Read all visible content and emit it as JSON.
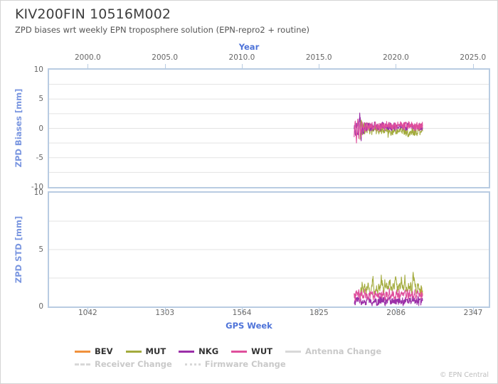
{
  "header": {
    "title": "KIV200FIN 10516M002",
    "subtitle": "ZPD biases wrt weekly EPN troposphere solution (EPN-repro2 + routine)"
  },
  "footer": {
    "copyright": "© EPN Central"
  },
  "colors": {
    "bev": "#f0913c",
    "mut": "#a3ab3d",
    "nkg": "#9b2fa8",
    "wut": "#df4f9c",
    "axis_title": "#4f74d9",
    "vaxis_title": "#7a96e0",
    "frame": "#b9cce2",
    "grid": "#e3e3e3",
    "tick_text": "#666666",
    "muted": "#d8d8d8"
  },
  "legend": {
    "series": [
      {
        "key": "bev",
        "label": "BEV",
        "color": "#f0913c",
        "style": "solid",
        "muted": false
      },
      {
        "key": "mut",
        "label": "MUT",
        "color": "#a3ab3d",
        "style": "solid",
        "muted": false
      },
      {
        "key": "nkg",
        "label": "NKG",
        "color": "#9b2fa8",
        "style": "solid",
        "muted": false
      },
      {
        "key": "wut",
        "label": "WUT",
        "color": "#df4f9c",
        "style": "solid",
        "muted": false
      },
      {
        "key": "antenna_change",
        "label": "Antenna Change",
        "color": "#d8d8d8",
        "style": "solid",
        "muted": true
      },
      {
        "key": "receiver_change",
        "label": "Receiver Change",
        "color": "#d8d8d8",
        "style": "dashed",
        "muted": true
      },
      {
        "key": "firmware_change",
        "label": "Firmware Change",
        "color": "#d8d8d8",
        "style": "dotted",
        "muted": true
      }
    ]
  },
  "chart_data": [
    {
      "id": "zpd-biases",
      "type": "line",
      "title": "ZPD Biases",
      "ylabel": "ZPD Biases [mm]",
      "xlabel_top": "Year",
      "xlabel_bottom": "GPS Week",
      "grid": true,
      "legend_position": "bottom",
      "ylim": [
        -10,
        10
      ],
      "yticks": [
        10,
        5,
        0,
        -5,
        -10
      ],
      "ytick_labels": [
        "10",
        "5",
        "0",
        "-5",
        "-10"
      ],
      "y_gridlines": [
        10,
        7.5,
        5,
        2.5,
        0,
        -2.5,
        -5,
        -7.5,
        -10
      ],
      "xlim_week": [
        911,
        2400
      ],
      "xticks_week": [
        1042,
        1303,
        1564,
        1825,
        2086,
        2347
      ],
      "xtick_labels_week": [
        "1042",
        "1303",
        "1564",
        "1825",
        "2086",
        "2347"
      ],
      "xlim_year": [
        2000.0,
        2025.0
      ],
      "xticks_year": [
        2000.0,
        2005.0,
        2010.0,
        2015.0,
        2020.0,
        2025.0
      ],
      "xtick_labels_year": [
        "2000.0",
        "2005.0",
        "2010.0",
        "2015.0",
        "2020.0",
        "2025.0"
      ],
      "data_week_range": [
        1944,
        2176
      ],
      "series": [
        {
          "name": "BEV",
          "color": "#f0913c",
          "x": [
            2170,
            2173,
            2176
          ],
          "values": [
            0.2,
            0.1,
            0.3
          ]
        },
        {
          "name": "MUT",
          "color": "#a3ab3d",
          "x": [
            1964,
            1968,
            1972,
            1976,
            1980,
            1984,
            1988,
            1992,
            1996,
            2000,
            2004,
            2008,
            2012,
            2016,
            2020,
            2024,
            2028,
            2032,
            2036,
            2040,
            2044,
            2048,
            2052,
            2056,
            2060,
            2064,
            2068,
            2072,
            2076,
            2080,
            2084,
            2088,
            2092,
            2096,
            2100,
            2104,
            2108,
            2112,
            2116,
            2120,
            2124,
            2128,
            2132,
            2136,
            2140,
            2144,
            2148,
            2152,
            2156,
            2160,
            2164,
            2168,
            2172,
            2176
          ],
          "values": [
            -2.1,
            1.4,
            -1.3,
            0.9,
            -0.7,
            0.6,
            -0.4,
            0.8,
            -0.5,
            0.3,
            -0.8,
            0.5,
            -0.6,
            0.4,
            -0.9,
            0.2,
            -0.7,
            0.1,
            -0.5,
            0.4,
            -0.6,
            -0.2,
            -0.8,
            -0.4,
            -0.9,
            -0.3,
            -0.7,
            -0.5,
            -0.8,
            -0.2,
            -0.6,
            -0.4,
            -0.9,
            -0.3,
            -0.7,
            -0.5,
            -0.4,
            -0.8,
            -0.3,
            -0.6,
            -0.5,
            -0.9,
            -0.4,
            -0.7,
            -0.3,
            -0.6,
            -0.8,
            -0.4,
            -0.5,
            -0.7,
            -0.3,
            -0.6,
            -0.4,
            -0.5
          ]
        },
        {
          "name": "NKG",
          "color": "#9b2fa8",
          "x": [
            1944,
            1948,
            1952,
            1956,
            1960,
            1964,
            1968,
            1972,
            1976,
            1980,
            1984,
            1988,
            1992,
            1996,
            2000,
            2004,
            2008,
            2012,
            2016,
            2020,
            2024,
            2028,
            2032,
            2036,
            2040,
            2044,
            2048,
            2052,
            2056,
            2060,
            2064,
            2068,
            2072,
            2076,
            2080,
            2084,
            2088,
            2092,
            2096,
            2100,
            2104,
            2108,
            2112,
            2116,
            2120,
            2124,
            2128,
            2132,
            2136,
            2140,
            2144,
            2148,
            2152,
            2156,
            2160,
            2164,
            2168,
            2172,
            2176
          ],
          "values": [
            0.6,
            -1.1,
            1.0,
            -1.5,
            0.8,
            2.4,
            -1.8,
            0.7,
            -0.9,
            0.5,
            0.3,
            -0.4,
            0.6,
            0.2,
            0.4,
            0.1,
            0.3,
            0.5,
            0.2,
            0.4,
            0.3,
            0.1,
            0.4,
            0.2,
            0.3,
            0.5,
            0.2,
            0.4,
            0.3,
            0.2,
            0.4,
            0.1,
            0.3,
            0.5,
            0.2,
            0.3,
            0.4,
            0.2,
            0.3,
            0.1,
            0.4,
            0.2,
            0.3,
            0.5,
            0.2,
            0.4,
            0.3,
            0.2,
            0.4,
            0.3,
            0.2,
            0.3,
            0.4,
            0.2,
            0.3,
            0.4,
            0.2,
            0.3,
            0.2
          ]
        },
        {
          "name": "WUT",
          "color": "#df4f9c",
          "x": [
            1944,
            1948,
            1952,
            1956,
            1960,
            1964,
            1968,
            1972,
            1976,
            1980,
            1984,
            1988,
            1992,
            1996,
            2000,
            2004,
            2008,
            2012,
            2016,
            2020,
            2024,
            2028,
            2032,
            2036,
            2040,
            2044,
            2048,
            2052,
            2056,
            2060,
            2064,
            2068,
            2072,
            2076,
            2080,
            2084,
            2088,
            2092,
            2096,
            2100,
            2104,
            2108,
            2112,
            2116,
            2120,
            2124,
            2128,
            2132,
            2136,
            2140,
            2144,
            2148,
            2152,
            2156,
            2160,
            2164,
            2168,
            2172,
            2176
          ],
          "values": [
            -1.4,
            1.2,
            -1.9,
            1.6,
            -2.0,
            0.9,
            -1.2,
            1.1,
            -0.6,
            0.8,
            -0.3,
            0.7,
            0.2,
            0.5,
            0.3,
            0.6,
            0.2,
            0.4,
            0.5,
            0.3,
            0.6,
            0.2,
            0.5,
            0.4,
            0.3,
            0.6,
            0.3,
            0.5,
            0.4,
            0.6,
            0.3,
            0.5,
            0.4,
            0.2,
            0.6,
            0.4,
            0.3,
            0.5,
            0.4,
            0.6,
            0.3,
            0.5,
            0.4,
            0.3,
            0.6,
            0.4,
            0.5,
            0.3,
            0.5,
            0.4,
            0.6,
            0.4,
            0.3,
            0.5,
            0.4,
            0.3,
            0.5,
            0.4,
            0.3
          ]
        }
      ]
    },
    {
      "id": "zpd-std",
      "type": "line",
      "title": "ZPD STD",
      "ylabel": "ZPD STD [mm]",
      "xlabel_bottom": "GPS Week",
      "grid": true,
      "ylim": [
        0,
        10
      ],
      "yticks": [
        10,
        5,
        0
      ],
      "ytick_labels": [
        "10",
        "5",
        "0"
      ],
      "y_gridlines": [
        10,
        7.5,
        5,
        2.5,
        0
      ],
      "xlim_week": [
        911,
        2400
      ],
      "xticks_week": [
        1042,
        1303,
        1564,
        1825,
        2086,
        2347
      ],
      "xtick_labels_week": [
        "1042",
        "1303",
        "1564",
        "1825",
        "2086",
        "2347"
      ],
      "data_week_range": [
        1944,
        2176
      ],
      "series": [
        {
          "name": "BEV",
          "color": "#f0913c",
          "x": [
            2168,
            2172,
            2176
          ],
          "values": [
            1.2,
            1.6,
            1.0
          ]
        },
        {
          "name": "MUT",
          "color": "#a3ab3d",
          "x": [
            1964,
            1968,
            1972,
            1976,
            1980,
            1984,
            1988,
            1992,
            1996,
            2000,
            2004,
            2008,
            2012,
            2016,
            2020,
            2024,
            2028,
            2032,
            2036,
            2040,
            2044,
            2048,
            2052,
            2056,
            2060,
            2064,
            2068,
            2072,
            2076,
            2080,
            2084,
            2088,
            2092,
            2096,
            2100,
            2104,
            2108,
            2112,
            2116,
            2120,
            2124,
            2128,
            2132,
            2136,
            2140,
            2144,
            2148,
            2152,
            2156,
            2160,
            2164,
            2168,
            2172,
            2176
          ],
          "values": [
            0.9,
            1.6,
            2.0,
            1.4,
            1.9,
            1.3,
            1.7,
            2.1,
            1.5,
            1.2,
            1.8,
            2.3,
            1.4,
            1.0,
            1.6,
            1.2,
            1.9,
            1.5,
            2.6,
            1.8,
            1.3,
            2.2,
            1.6,
            2.0,
            1.4,
            2.4,
            1.7,
            1.2,
            2.1,
            1.5,
            2.7,
            1.9,
            1.4,
            2.0,
            1.6,
            2.3,
            1.8,
            1.3,
            2.5,
            1.7,
            1.2,
            2.0,
            1.5,
            1.9,
            1.4,
            2.9,
            2.1,
            1.6,
            1.3,
            1.8,
            1.5,
            1.2,
            1.7,
            1.4
          ]
        },
        {
          "name": "NKG",
          "color": "#9b2fa8",
          "x": [
            1944,
            1952,
            1960,
            1968,
            1976,
            1984,
            1992,
            2000,
            2008,
            2016,
            2024,
            2032,
            2040,
            2048,
            2056,
            2064,
            2072,
            2080,
            2088,
            2096,
            2104,
            2112,
            2120,
            2128,
            2136,
            2144,
            2152,
            2160,
            2168,
            2176
          ],
          "values": [
            0.5,
            0.4,
            0.6,
            0.4,
            0.5,
            0.4,
            0.6,
            0.5,
            0.4,
            0.5,
            0.4,
            0.6,
            0.5,
            0.4,
            0.5,
            0.6,
            0.4,
            0.5,
            0.4,
            0.6,
            0.5,
            0.4,
            0.5,
            0.4,
            0.6,
            0.5,
            0.4,
            0.5,
            0.4,
            0.5
          ]
        },
        {
          "name": "WUT",
          "color": "#df4f9c",
          "x": [
            1944,
            1948,
            1952,
            1956,
            1960,
            1964,
            1968,
            1972,
            1976,
            1980,
            1984,
            1988,
            1992,
            1996,
            2000,
            2004,
            2008,
            2012,
            2016,
            2020,
            2024,
            2028,
            2032,
            2036,
            2040,
            2044,
            2048,
            2052,
            2056,
            2060,
            2064,
            2068,
            2072,
            2076,
            2080,
            2084,
            2088,
            2092,
            2096,
            2100,
            2104,
            2108,
            2112,
            2116,
            2120,
            2124,
            2128,
            2132,
            2136,
            2140,
            2144,
            2148,
            2152,
            2156,
            2160,
            2164,
            2168,
            2172,
            2176
          ],
          "values": [
            1.1,
            0.8,
            1.3,
            0.9,
            1.2,
            0.7,
            1.4,
            1.0,
            0.8,
            1.3,
            0.9,
            1.1,
            0.7,
            1.2,
            0.9,
            1.4,
            1.0,
            0.8,
            1.2,
            0.9,
            1.1,
            0.8,
            1.3,
            1.0,
            0.9,
            1.2,
            0.8,
            1.1,
            1.0,
            0.9,
            1.3,
            0.8,
            1.1,
            1.2,
            0.9,
            1.0,
            1.3,
            0.8,
            1.1,
            0.9,
            1.2,
            1.0,
            0.8,
            1.3,
            0.9,
            1.1,
            1.0,
            1.2,
            0.8,
            1.1,
            0.9,
            1.3,
            1.0,
            0.8,
            1.2,
            0.9,
            1.1,
            1.0,
            0.9
          ]
        }
      ]
    }
  ]
}
